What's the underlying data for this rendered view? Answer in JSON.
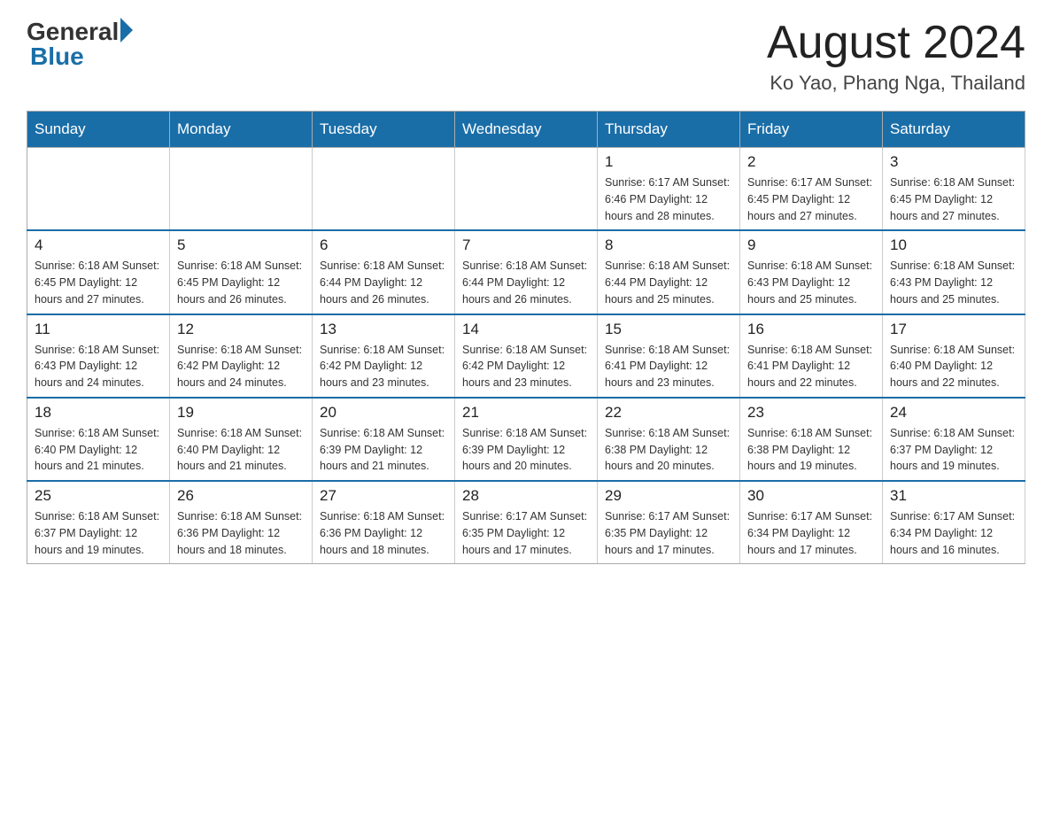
{
  "header": {
    "logo_general": "General",
    "logo_blue": "Blue",
    "month_year": "August 2024",
    "location": "Ko Yao, Phang Nga, Thailand"
  },
  "weekdays": [
    "Sunday",
    "Monday",
    "Tuesday",
    "Wednesday",
    "Thursday",
    "Friday",
    "Saturday"
  ],
  "weeks": [
    [
      {
        "day": "",
        "info": ""
      },
      {
        "day": "",
        "info": ""
      },
      {
        "day": "",
        "info": ""
      },
      {
        "day": "",
        "info": ""
      },
      {
        "day": "1",
        "info": "Sunrise: 6:17 AM\nSunset: 6:46 PM\nDaylight: 12 hours and 28 minutes."
      },
      {
        "day": "2",
        "info": "Sunrise: 6:17 AM\nSunset: 6:45 PM\nDaylight: 12 hours and 27 minutes."
      },
      {
        "day": "3",
        "info": "Sunrise: 6:18 AM\nSunset: 6:45 PM\nDaylight: 12 hours and 27 minutes."
      }
    ],
    [
      {
        "day": "4",
        "info": "Sunrise: 6:18 AM\nSunset: 6:45 PM\nDaylight: 12 hours and 27 minutes."
      },
      {
        "day": "5",
        "info": "Sunrise: 6:18 AM\nSunset: 6:45 PM\nDaylight: 12 hours and 26 minutes."
      },
      {
        "day": "6",
        "info": "Sunrise: 6:18 AM\nSunset: 6:44 PM\nDaylight: 12 hours and 26 minutes."
      },
      {
        "day": "7",
        "info": "Sunrise: 6:18 AM\nSunset: 6:44 PM\nDaylight: 12 hours and 26 minutes."
      },
      {
        "day": "8",
        "info": "Sunrise: 6:18 AM\nSunset: 6:44 PM\nDaylight: 12 hours and 25 minutes."
      },
      {
        "day": "9",
        "info": "Sunrise: 6:18 AM\nSunset: 6:43 PM\nDaylight: 12 hours and 25 minutes."
      },
      {
        "day": "10",
        "info": "Sunrise: 6:18 AM\nSunset: 6:43 PM\nDaylight: 12 hours and 25 minutes."
      }
    ],
    [
      {
        "day": "11",
        "info": "Sunrise: 6:18 AM\nSunset: 6:43 PM\nDaylight: 12 hours and 24 minutes."
      },
      {
        "day": "12",
        "info": "Sunrise: 6:18 AM\nSunset: 6:42 PM\nDaylight: 12 hours and 24 minutes."
      },
      {
        "day": "13",
        "info": "Sunrise: 6:18 AM\nSunset: 6:42 PM\nDaylight: 12 hours and 23 minutes."
      },
      {
        "day": "14",
        "info": "Sunrise: 6:18 AM\nSunset: 6:42 PM\nDaylight: 12 hours and 23 minutes."
      },
      {
        "day": "15",
        "info": "Sunrise: 6:18 AM\nSunset: 6:41 PM\nDaylight: 12 hours and 23 minutes."
      },
      {
        "day": "16",
        "info": "Sunrise: 6:18 AM\nSunset: 6:41 PM\nDaylight: 12 hours and 22 minutes."
      },
      {
        "day": "17",
        "info": "Sunrise: 6:18 AM\nSunset: 6:40 PM\nDaylight: 12 hours and 22 minutes."
      }
    ],
    [
      {
        "day": "18",
        "info": "Sunrise: 6:18 AM\nSunset: 6:40 PM\nDaylight: 12 hours and 21 minutes."
      },
      {
        "day": "19",
        "info": "Sunrise: 6:18 AM\nSunset: 6:40 PM\nDaylight: 12 hours and 21 minutes."
      },
      {
        "day": "20",
        "info": "Sunrise: 6:18 AM\nSunset: 6:39 PM\nDaylight: 12 hours and 21 minutes."
      },
      {
        "day": "21",
        "info": "Sunrise: 6:18 AM\nSunset: 6:39 PM\nDaylight: 12 hours and 20 minutes."
      },
      {
        "day": "22",
        "info": "Sunrise: 6:18 AM\nSunset: 6:38 PM\nDaylight: 12 hours and 20 minutes."
      },
      {
        "day": "23",
        "info": "Sunrise: 6:18 AM\nSunset: 6:38 PM\nDaylight: 12 hours and 19 minutes."
      },
      {
        "day": "24",
        "info": "Sunrise: 6:18 AM\nSunset: 6:37 PM\nDaylight: 12 hours and 19 minutes."
      }
    ],
    [
      {
        "day": "25",
        "info": "Sunrise: 6:18 AM\nSunset: 6:37 PM\nDaylight: 12 hours and 19 minutes."
      },
      {
        "day": "26",
        "info": "Sunrise: 6:18 AM\nSunset: 6:36 PM\nDaylight: 12 hours and 18 minutes."
      },
      {
        "day": "27",
        "info": "Sunrise: 6:18 AM\nSunset: 6:36 PM\nDaylight: 12 hours and 18 minutes."
      },
      {
        "day": "28",
        "info": "Sunrise: 6:17 AM\nSunset: 6:35 PM\nDaylight: 12 hours and 17 minutes."
      },
      {
        "day": "29",
        "info": "Sunrise: 6:17 AM\nSunset: 6:35 PM\nDaylight: 12 hours and 17 minutes."
      },
      {
        "day": "30",
        "info": "Sunrise: 6:17 AM\nSunset: 6:34 PM\nDaylight: 12 hours and 17 minutes."
      },
      {
        "day": "31",
        "info": "Sunrise: 6:17 AM\nSunset: 6:34 PM\nDaylight: 12 hours and 16 minutes."
      }
    ]
  ]
}
